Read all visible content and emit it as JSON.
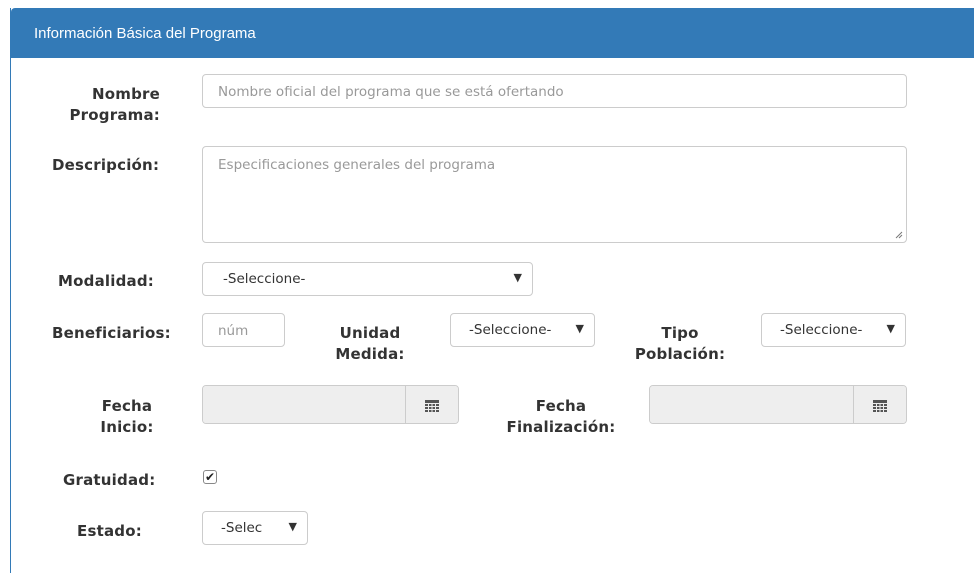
{
  "panel": {
    "title": "Información Básica del Programa"
  },
  "labels": {
    "nombre": "Nombre Programa:",
    "descripcion": "Descripción:",
    "modalidad": "Modalidad:",
    "beneficiarios": "Beneficiarios:",
    "unidad_medida": "Unidad Medida:",
    "tipo_poblacion": "Tipo Población:",
    "fecha_inicio": "Fecha Inicio:",
    "fecha_fin": "Fecha Finalización:",
    "gratuidad": "Gratuidad:",
    "estado": "Estado:"
  },
  "fields": {
    "nombre_placeholder": "Nombre oficial del programa que se está ofertando",
    "descripcion_placeholder": "Especificaciones generales del programa",
    "modalidad_value": "-Seleccione-",
    "beneficiarios_placeholder": "núm",
    "unidad_value": "-Seleccione-",
    "tipo_value": "-Seleccione-",
    "estado_value": "-Seleccione-",
    "gratuidad_checked": true
  },
  "icons": {
    "dropdown": "chevron-down-icon",
    "calendar": "calendar-icon",
    "checkbox": "checkmark-icon"
  },
  "colors": {
    "header_bg": "#337ab7",
    "readonly_bg": "#eeeeee",
    "border": "#cccccc"
  }
}
